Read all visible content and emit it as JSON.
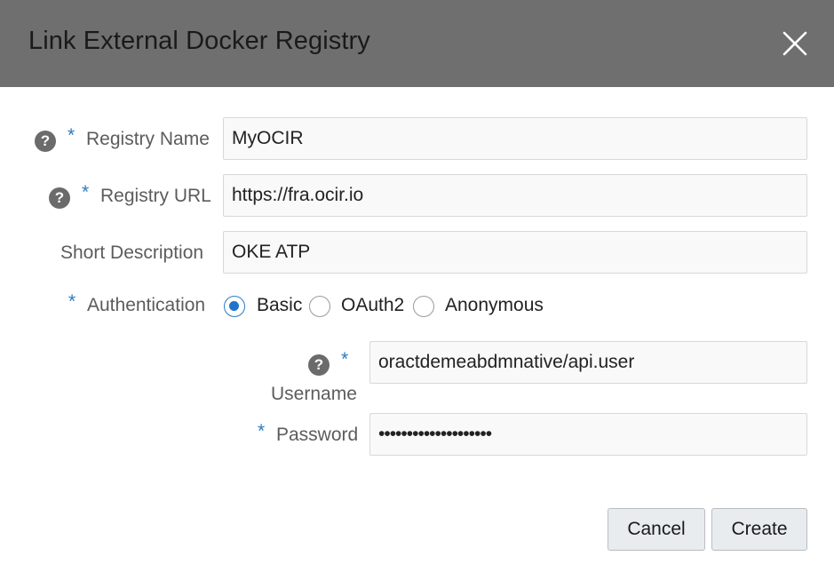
{
  "dialog": {
    "title": "Link External Docker Registry",
    "close_icon": "close-icon"
  },
  "form": {
    "required_marker": "*",
    "help_glyph": "?",
    "registry_name": {
      "label": "Registry Name",
      "value": "MyOCIR"
    },
    "registry_url": {
      "label": "Registry URL",
      "value": "https://fra.ocir.io"
    },
    "short_description": {
      "label": "Short Description",
      "value": "OKE ATP"
    },
    "authentication": {
      "label": "Authentication",
      "options": [
        "Basic",
        "OAuth2",
        "Anonymous"
      ],
      "selected": "Basic"
    },
    "username": {
      "label": "Username",
      "value": "oractdemeabdmnative/api.user"
    },
    "password": {
      "label": "Password",
      "value": "••••••••••••••••••••"
    }
  },
  "buttons": {
    "cancel": "Cancel",
    "create": "Create"
  },
  "colors": {
    "header_bg": "#6f6f6f",
    "required": "#2b79c2",
    "radio_selected": "#1f73c8"
  }
}
